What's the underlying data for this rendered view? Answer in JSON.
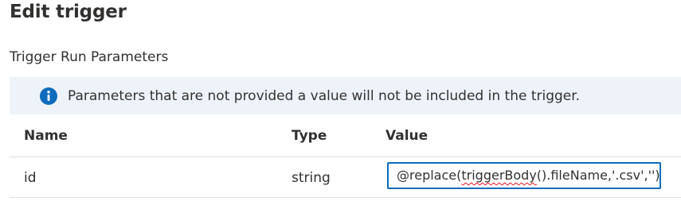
{
  "panel": {
    "title": "Edit trigger",
    "section_label": "Trigger Run Parameters"
  },
  "info_bar": {
    "icon": "info-icon",
    "message": "Parameters that are not provided a value will not be included in the trigger.",
    "accent_color": "#0f6cbd",
    "background_color": "#eef3fa"
  },
  "table": {
    "headers": {
      "name": "Name",
      "type": "Type",
      "value": "Value"
    },
    "rows": [
      {
        "name": "id",
        "type": "string",
        "value_prefix": "@replace(",
        "value_misspelled": "triggerBody",
        "value_suffix": "().fileName,'.csv','')"
      }
    ]
  }
}
